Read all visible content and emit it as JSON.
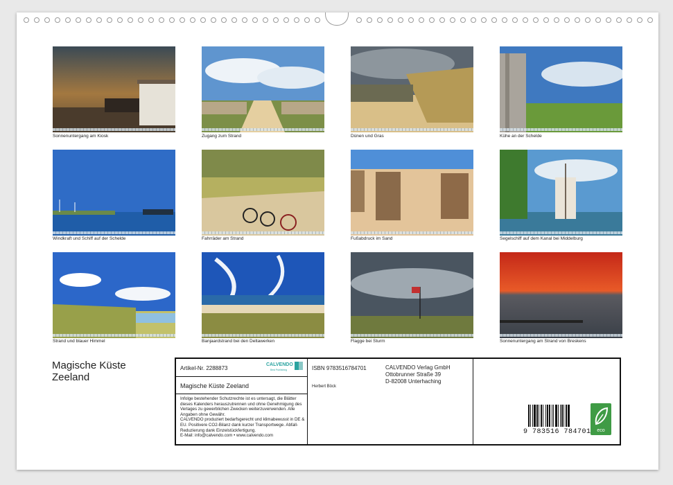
{
  "calendar_title_line1": "Magische Küste",
  "calendar_title_line2": "Zeeland",
  "photos": [
    {
      "caption": "Sonnenuntergang am Kiosk"
    },
    {
      "caption": "Zugang zum Strand"
    },
    {
      "caption": "Dünen und Gras"
    },
    {
      "caption": "Kühe an der Schelde"
    },
    {
      "caption": "Windkraft und Schiff auf der Schelde"
    },
    {
      "caption": "Fahrräder am Strand"
    },
    {
      "caption": "Fußabdruck im Sand"
    },
    {
      "caption": "Segelschiff auf dem Kanal bei Middelburg"
    },
    {
      "caption": "Strand und blauer Himmel"
    },
    {
      "caption": "Banjaardstrand bei den Deltawerken"
    },
    {
      "caption": "Flagge bei Sturm"
    },
    {
      "caption": "Sonnenuntergang am Strand von Breskens"
    }
  ],
  "info": {
    "article_no": "Artikel-Nr. 2288873",
    "calvendo_logo": "CALVENDO",
    "calvendo_sub": "Best Publishing",
    "product_title": "Magische Küste Zeeland",
    "isbn": "ISBN 9783516784701",
    "publisher_name": "CALVENDO Verlag GmbH",
    "publisher_street": "Ottobrunner Straße 39",
    "publisher_city": "D-82008 Unterhaching",
    "author": "Herbert Böck",
    "legal_1": "Infolge bestehender Schutzrechte ist es untersagt, die Blätter dieses Kalenders herauszutrennen und ohne Genehmigung des Verlages zu gewerblichen Zwecken weiterzuverwenden. Alle Angaben ohne Gewähr.",
    "legal_2": "CALVENDO produziert bedarfsgerecht und klimabewusst in DE & EU. Positivere CO2-Bilanz dank kurzer Transportwege. Abfall-Reduzierung dank Einzelstückfertigung.",
    "legal_3": "E-Mail: info@calvendo.com • www.calvendo.com",
    "barcode_digits": "9  783516  784701",
    "eco_label": "eco"
  },
  "colors": {
    "border": "#111111",
    "eco_green": "#3f9b45",
    "calvendo_teal": "#2aa3a0"
  }
}
